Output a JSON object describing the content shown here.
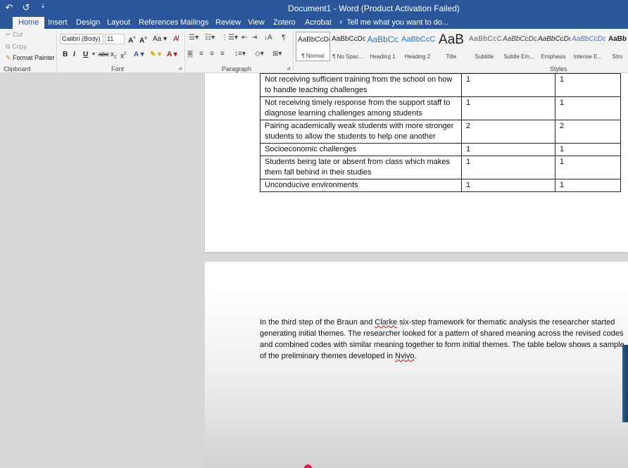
{
  "titlebar": {
    "title": "Document1 - Word (Product Activation Failed)",
    "qat": [
      "↶",
      "↺",
      "⇣"
    ]
  },
  "tabs": [
    "Home",
    "Insert",
    "Design",
    "Layout",
    "References",
    "Mailings",
    "Review",
    "View",
    "Zotero",
    "Acrobat"
  ],
  "tell_me": "Tell me what you want to do...",
  "ribbon": {
    "clipboard": {
      "cut": "Cut",
      "copy": "Copy",
      "format_painter": "Format Painter",
      "label": "Clipboard"
    },
    "font": {
      "name": "Calibri (Body)",
      "size": "11",
      "label": "Font"
    },
    "paragraph": {
      "label": "Paragraph"
    },
    "styles": {
      "label": "Styles",
      "items": [
        {
          "sample": "AaBbCcDc",
          "name": "¶ Normal"
        },
        {
          "sample": "AaBbCcDc",
          "name": "¶ No Spac..."
        },
        {
          "sample": "AaBbCc",
          "name": "Heading 1"
        },
        {
          "sample": "AaBbCcC",
          "name": "Heading 2"
        },
        {
          "sample": "AaB",
          "name": "Title"
        },
        {
          "sample": "AaBbCcC",
          "name": "Subtitle"
        },
        {
          "sample": "AaBbCcDc",
          "name": "Subtle Em..."
        },
        {
          "sample": "AaBbCcDc",
          "name": "Emphasis"
        },
        {
          "sample": "AaBbCcDc",
          "name": "Intense E..."
        },
        {
          "sample": "AaBb",
          "name": "Stro"
        }
      ]
    }
  },
  "table": {
    "rows": [
      {
        "text": "Not receiving sufficient training from the school on how to handle teaching challenges",
        "a": "1",
        "b": "1"
      },
      {
        "text": "Not receiving timely response from the support staff to diagnose learning challenges among students",
        "a": "1",
        "b": "1"
      },
      {
        "text": "Pairing academically weak students with more stronger students to allow the students to help one another",
        "a": "2",
        "b": "2"
      },
      {
        "text": "Socioeconomic challenges",
        "a": "1",
        "b": "1"
      },
      {
        "text": "Students being late or absent from class which makes them fall behind in their studies",
        "a": "1",
        "b": "1"
      },
      {
        "text": "Unconducive environments",
        "a": "1",
        "b": "1"
      }
    ]
  },
  "paragraph": {
    "p1": "In the third step of the Braun and ",
    "p2": "Clarke",
    "p3": " six-step framework for thematic analysis the researcher started generating initial themes. The researcher looked for a pattern of shared meaning across the revised codes and combined codes with similar meaning together to form initial themes. The table below shows a sample of the preliminary themes developed in ",
    "p4": "Nvivo",
    "p5": "."
  }
}
